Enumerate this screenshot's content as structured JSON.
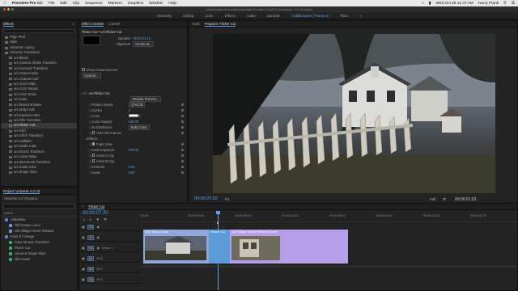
{
  "menubar": {
    "app": "Premiere Pro CC",
    "items": [
      "File",
      "Edit",
      "Clip",
      "Sequence",
      "Markers",
      "Graphics",
      "Window",
      "Help"
    ],
    "clock": "Wed Oct 25 11:47 AM",
    "user": "Harry Frank"
  },
  "window": {
    "path": "/Users/rfranc/Documents/Adobe/Premiere Pro/11.0/Universe 2.2 V3.prproj"
  },
  "workspaces": {
    "items": [
      "Assembly",
      "Editing",
      "Color",
      "Effects",
      "Audio",
      "Libraries",
      "Collaboration | Frame.io",
      "Titles"
    ],
    "active_index": 6
  },
  "effects_panel": {
    "title": "Effects",
    "items": [
      {
        "label": "Page Peel",
        "kind": "folder",
        "indent": 1
      },
      {
        "label": "Slide",
        "kind": "folder",
        "indent": 1
      },
      {
        "label": "Universe Legacy",
        "kind": "folder",
        "indent": 1
      },
      {
        "label": "Universe Transitions",
        "kind": "folder",
        "indent": 1
      },
      {
        "label": "uni.Blinds",
        "kind": "fx",
        "indent": 2
      },
      {
        "label": "uni.Camera Shake Transition",
        "kind": "fx",
        "indent": 2
      },
      {
        "label": "uni.Carousel Transition",
        "kind": "fx",
        "indent": 2
      },
      {
        "label": "uni.Channel Blur",
        "kind": "fx",
        "indent": 2
      },
      {
        "label": "uni.Channel Surf",
        "kind": "fx",
        "indent": 2
      },
      {
        "label": "uni.Clock Wipe",
        "kind": "fx",
        "indent": 2
      },
      {
        "label": "uni.Color Mosaic",
        "kind": "fx",
        "indent": 2
      },
      {
        "label": "uni.Color Stripe",
        "kind": "fx",
        "indent": 2
      },
      {
        "label": "uni.Cube",
        "kind": "fx",
        "indent": 2
      },
      {
        "label": "uni.Diamond Wave",
        "kind": "fx",
        "indent": 2
      },
      {
        "label": "uni.Dolly Fade",
        "kind": "fx",
        "indent": 2
      },
      {
        "label": "uni.Exposure Blur",
        "kind": "fx",
        "indent": 2
      },
      {
        "label": "uni.Film Transition",
        "kind": "fx",
        "indent": 2
      },
      {
        "label": "uni.Flicker Cut",
        "kind": "fx",
        "indent": 2,
        "selected": true
      },
      {
        "label": "uni.Fold",
        "kind": "fx",
        "indent": 2
      },
      {
        "label": "uni.Glitch Transition",
        "kind": "fx",
        "indent": 2
      },
      {
        "label": "uni.Halftight",
        "kind": "fx",
        "indent": 2
      },
      {
        "label": "uni.Inside Cube",
        "kind": "fx",
        "indent": 2
      },
      {
        "label": "uni.Kinetic Transition",
        "kind": "fx",
        "indent": 2
      },
      {
        "label": "uni.Linear Wipe",
        "kind": "fx",
        "indent": 2
      },
      {
        "label": "uni.MicroKnob Transition",
        "kind": "fx",
        "indent": 2
      },
      {
        "label": "uni.Rubik Cube",
        "kind": "fx",
        "indent": 2
      },
      {
        "label": "uni.Shape Wipe",
        "kind": "fx",
        "indent": 2
      }
    ]
  },
  "effect_controls": {
    "tab": "Effect Controls",
    "tab2": "Lumetri",
    "subtitle": "Flicker Cut • uni.Flicker Cut",
    "duration_label": "Duration",
    "duration_value": "00:00:01:14",
    "alignment_label": "Alignment",
    "alignment_value": "Center at...",
    "show_sources": "Show Actual Sources",
    "custom_btn": "Custom...",
    "section": "uni.Flicker Cut",
    "browse_btn": "Browse Presets...",
    "params": [
      {
        "label": "Pattern Seeds",
        "value": "C/A/C/B",
        "kind": "field"
      },
      {
        "label": "Cycles",
        "value": "2",
        "kind": "num"
      },
      {
        "label": "Color",
        "value": "",
        "kind": "swatch"
      },
      {
        "label": "Color Opacity",
        "value": "100.00",
        "kind": "num"
      },
      {
        "label": "End Behavior",
        "value": "Solid Color",
        "kind": "field"
      },
      {
        "label": "Hold A/B Frames",
        "value": "",
        "kind": "check"
      },
      {
        "label": "Effects",
        "value": "",
        "kind": "group"
      },
      {
        "label": "Fade Glow",
        "value": "",
        "kind": "check_on"
      },
      {
        "label": "Fade Exposure",
        "value": "100.00",
        "kind": "num"
      },
      {
        "label": "Invert A Clip",
        "value": "",
        "kind": "check"
      },
      {
        "label": "Invert B Clip",
        "value": "",
        "kind": "check"
      },
      {
        "label": "Contrast",
        "value": "0.00",
        "kind": "num"
      },
      {
        "label": "Noise",
        "value": "0.00",
        "kind": "num"
      }
    ],
    "footer_time": "00:00:07:20"
  },
  "program_monitor": {
    "tabs": [
      "Tools",
      "Program: Flicker Cut"
    ],
    "timecode": "00:00:07:20",
    "fit": "Fit",
    "quality": "Full",
    "duration": "00:00:01:03"
  },
  "project_panel": {
    "title": "Project: Universe 2.2 V3",
    "file": "Universe 2.2 V3.prproj",
    "name_header": "Name",
    "items": [
      {
        "label": "VideoHive",
        "color": "#5a7dd4",
        "indent": 1
      },
      {
        "label": "Old House 1.mov",
        "color": "#6e8fdc",
        "indent": 2
      },
      {
        "label": "Old Village House Window",
        "color": "#6e8fdc",
        "indent": 2
      },
      {
        "label": "Pond 5 Footage",
        "color": "#5a7dd4",
        "indent": 1
      },
      {
        "label": "Color Mosaic Transition",
        "color": "#3aa86b",
        "indent": 2
      },
      {
        "label": "Flicker Cut",
        "color": "#3aa86b",
        "indent": 2
      },
      {
        "label": "Linear & Shape Wipe",
        "color": "#3aa86b",
        "indent": 2
      },
      {
        "label": "Old House",
        "color": "#3aa86b",
        "indent": 2
      }
    ]
  },
  "timeline": {
    "tab": "Flicker Cut",
    "timecode": "00:00:07:20",
    "ruler": [
      "00:00",
      "00:00:04:23",
      "00:00:09:23",
      "00:00:14:23",
      "00:00:19:23",
      "00:00:24:23",
      "00:00:29:23",
      "00:00:34:23"
    ],
    "video_tracks": [
      "V3",
      "V2",
      "V1"
    ],
    "audio_tracks": [
      "A1",
      "A2",
      "A3"
    ],
    "video_label": "Video 1",
    "clip_a": "Old House 1.mov",
    "clip_b": "Old Village House Window 2.mov",
    "transition": "Flicker Cut"
  },
  "colors": {
    "accent": "#5aa3ea",
    "clip_a": "#8fa8dc",
    "clip_b": "#b79ee8",
    "transition": "#5b9bd8"
  }
}
